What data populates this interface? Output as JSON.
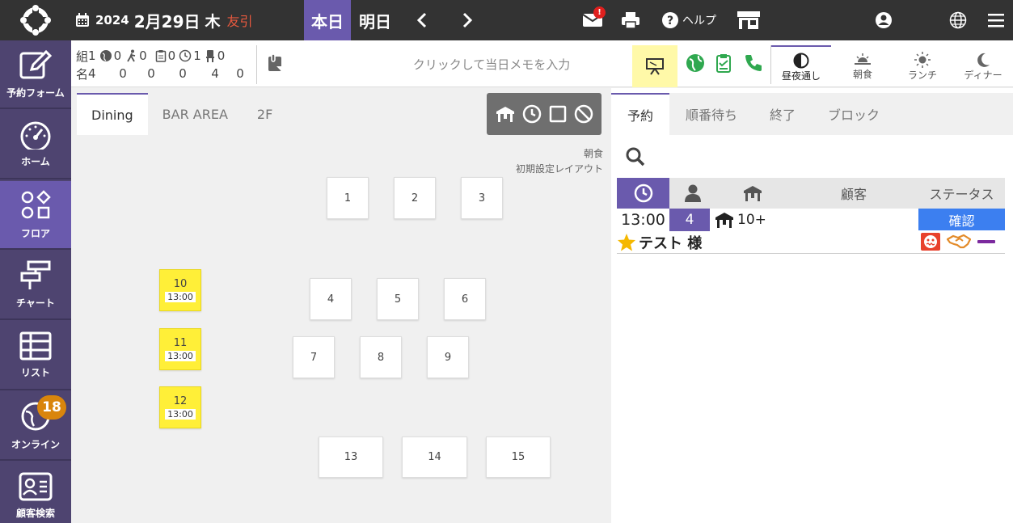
{
  "header": {
    "year": "2024",
    "month_day": "2月29日",
    "weekday": "木",
    "rokuyo": "友引",
    "today_label": "本日",
    "tomorrow_label": "明日",
    "mail_badge": "!",
    "help_label": "ヘルプ"
  },
  "sidebar": {
    "items": [
      {
        "label": "予約フォーム",
        "icon": "edit-icon"
      },
      {
        "label": "ホーム",
        "icon": "dashboard-icon"
      },
      {
        "label": "フロア",
        "icon": "floor-icon"
      },
      {
        "label": "チャート",
        "icon": "chart-icon"
      },
      {
        "label": "リスト",
        "icon": "list-icon"
      },
      {
        "label": "オンライン",
        "icon": "globe-icon",
        "badge": "18"
      },
      {
        "label": "顧客検索",
        "icon": "customer-card-icon"
      }
    ],
    "active_index": 2
  },
  "stats": {
    "row1": [
      "組",
      "1",
      "0",
      "0",
      "0",
      "1",
      "0"
    ],
    "row2": [
      "名",
      "4",
      "0",
      "0",
      "0",
      "4",
      "0"
    ]
  },
  "memo": {
    "placeholder": "クリックして当日メモを入力"
  },
  "meal_tabs": [
    {
      "label": "昼夜通し",
      "active": true
    },
    {
      "label": "朝食",
      "active": false
    },
    {
      "label": "ランチ",
      "active": false
    },
    {
      "label": "ディナー",
      "active": false
    }
  ],
  "floor": {
    "tabs": [
      "Dining",
      "BAR AREA",
      "2F"
    ],
    "active_tab": 0,
    "meal": "朝食",
    "layout_name": "初期設定レイアウト",
    "tables": [
      {
        "no": "1"
      },
      {
        "no": "2"
      },
      {
        "no": "3"
      },
      {
        "no": "4"
      },
      {
        "no": "5"
      },
      {
        "no": "6"
      },
      {
        "no": "7"
      },
      {
        "no": "8"
      },
      {
        "no": "9"
      },
      {
        "no": "10",
        "time": "13:00",
        "reserved": true
      },
      {
        "no": "11",
        "time": "13:00",
        "reserved": true
      },
      {
        "no": "12",
        "time": "13:00",
        "reserved": true
      },
      {
        "no": "13"
      },
      {
        "no": "14"
      },
      {
        "no": "15"
      }
    ]
  },
  "reservations": {
    "tabs": [
      "予約",
      "順番待ち",
      "終了",
      "ブロック"
    ],
    "active_tab": 0,
    "columns": {
      "customer": "顧客",
      "status": "ステータス"
    },
    "rows": [
      {
        "time": "13:00",
        "count": "4",
        "seat": "10+",
        "name": "テスト 様",
        "status": "確認"
      }
    ]
  },
  "colors": {
    "accent": "#6a5aad",
    "topbar": "#333333",
    "sidebar": "#4e4470",
    "reserved_table": "#ffef38",
    "status_confirm": "#3c7ff0",
    "badge": "#d9850c"
  }
}
